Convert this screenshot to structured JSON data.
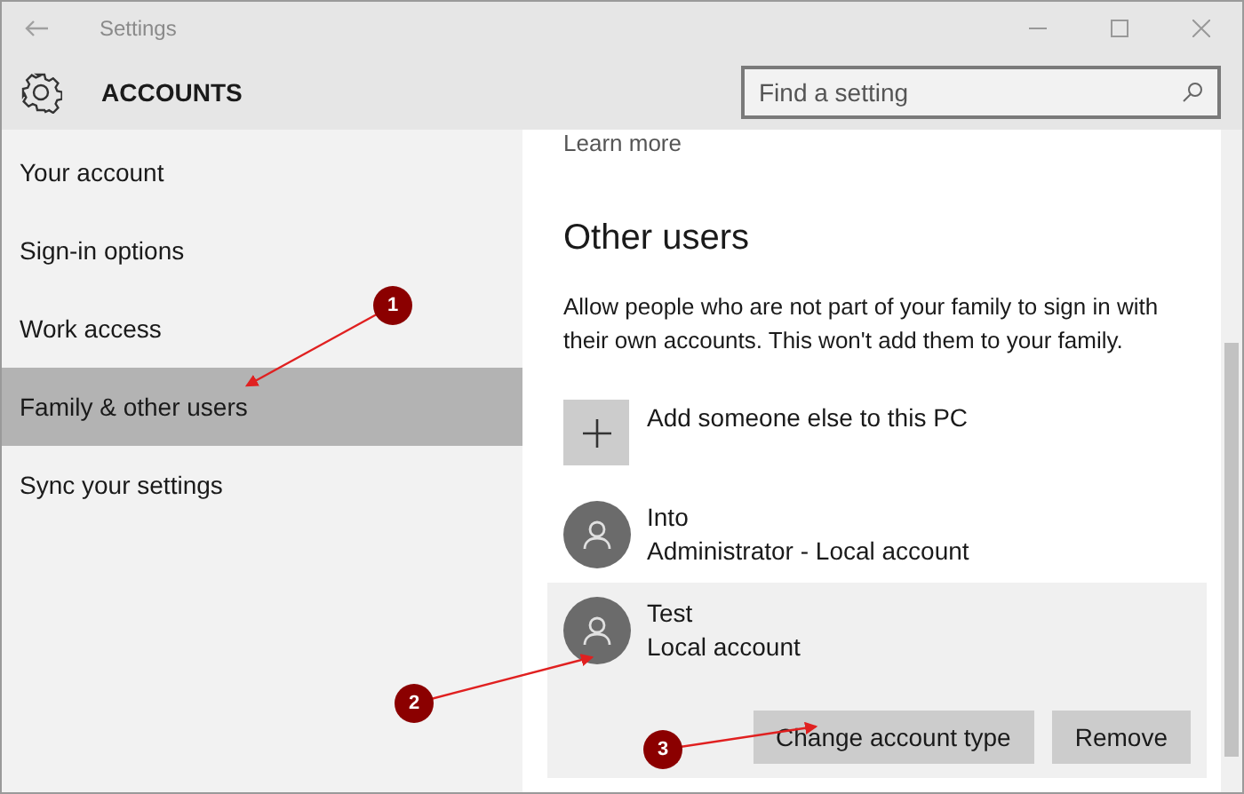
{
  "window": {
    "title": "Settings"
  },
  "header": {
    "title": "ACCOUNTS",
    "search": {
      "placeholder": "Find a setting"
    }
  },
  "sidebar": {
    "items": [
      {
        "label": "Your account",
        "selected": false
      },
      {
        "label": "Sign-in options",
        "selected": false
      },
      {
        "label": "Work access",
        "selected": false
      },
      {
        "label": "Family & other users",
        "selected": true
      },
      {
        "label": "Sync your settings",
        "selected": false
      }
    ]
  },
  "content": {
    "link": "Learn more",
    "heading": "Other users",
    "description": "Allow people who are not part of your family to sign in with their own accounts. This won't add them to your family.",
    "add_button": "Add someone else to this PC",
    "users": [
      {
        "name": "Into",
        "type": "Administrator - Local account",
        "selected": false
      },
      {
        "name": "Test",
        "type": "Local account",
        "selected": true
      }
    ],
    "actions": [
      "Change account type",
      "Remove"
    ]
  },
  "annotations": [
    {
      "label": "1"
    },
    {
      "label": "2"
    },
    {
      "label": "3"
    }
  ]
}
